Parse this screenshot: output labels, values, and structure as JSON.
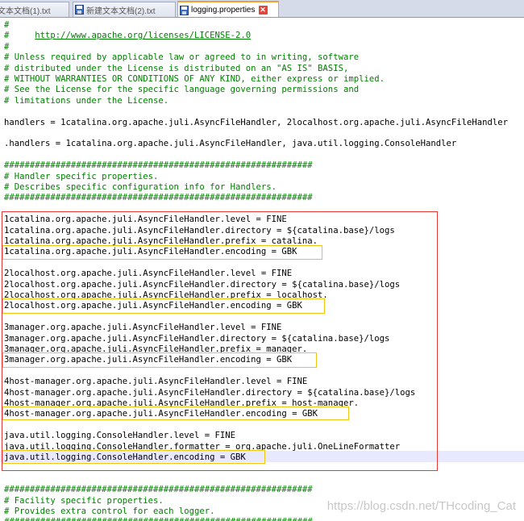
{
  "tabs": [
    {
      "label": "文本文档(1).txt",
      "active": false
    },
    {
      "label": "新建文本文档(2).txt",
      "active": false
    },
    {
      "label": "logging.properties",
      "active": true
    }
  ],
  "lines": [
    {
      "text": "#",
      "type": "comment"
    },
    {
      "text": "#     http://www.apache.org/licenses/LICENSE-2.0",
      "type": "comment"
    },
    {
      "text": "#",
      "type": "comment"
    },
    {
      "text": "# Unless required by applicable law or agreed to in writing, software",
      "type": "comment"
    },
    {
      "text": "# distributed under the License is distributed on an \"AS IS\" BASIS,",
      "type": "comment"
    },
    {
      "text": "# WITHOUT WARRANTIES OR CONDITIONS OF ANY KIND, either express or implied.",
      "type": "comment"
    },
    {
      "text": "# See the License for the specific language governing permissions and",
      "type": "comment"
    },
    {
      "text": "# limitations under the License.",
      "type": "comment"
    },
    {
      "text": "",
      "type": "code"
    },
    {
      "text": "handlers = 1catalina.org.apache.juli.AsyncFileHandler, 2localhost.org.apache.juli.AsyncFileHandler",
      "type": "code"
    },
    {
      "text": "",
      "type": "code"
    },
    {
      "text": ".handlers = 1catalina.org.apache.juli.AsyncFileHandler, java.util.logging.ConsoleHandler",
      "type": "code"
    },
    {
      "text": "",
      "type": "code"
    },
    {
      "text": "############################################################",
      "type": "comment"
    },
    {
      "text": "# Handler specific properties.",
      "type": "comment"
    },
    {
      "text": "# Describes specific configuration info for Handlers.",
      "type": "comment"
    },
    {
      "text": "############################################################",
      "type": "comment"
    },
    {
      "text": "",
      "type": "code"
    },
    {
      "text": "1catalina.org.apache.juli.AsyncFileHandler.level = FINE",
      "type": "code"
    },
    {
      "text": "1catalina.org.apache.juli.AsyncFileHandler.directory = ${catalina.base}/logs",
      "type": "code"
    },
    {
      "text": "1catalina.org.apache.juli.AsyncFileHandler.prefix = catalina.",
      "type": "code"
    },
    {
      "text": "1catalina.org.apache.juli.AsyncFileHandler.encoding = GBK",
      "type": "code"
    },
    {
      "text": "",
      "type": "code"
    },
    {
      "text": "2localhost.org.apache.juli.AsyncFileHandler.level = FINE",
      "type": "code"
    },
    {
      "text": "2localhost.org.apache.juli.AsyncFileHandler.directory = ${catalina.base}/logs",
      "type": "code"
    },
    {
      "text": "2localhost.org.apache.juli.AsyncFileHandler.prefix = localhost.",
      "type": "code"
    },
    {
      "text": "2localhost.org.apache.juli.AsyncFileHandler.encoding = GBK",
      "type": "code"
    },
    {
      "text": "",
      "type": "code"
    },
    {
      "text": "3manager.org.apache.juli.AsyncFileHandler.level = FINE",
      "type": "code"
    },
    {
      "text": "3manager.org.apache.juli.AsyncFileHandler.directory = ${catalina.base}/logs",
      "type": "code"
    },
    {
      "text": "3manager.org.apache.juli.AsyncFileHandler.prefix = manager.",
      "type": "code"
    },
    {
      "text": "3manager.org.apache.juli.AsyncFileHandler.encoding = GBK",
      "type": "code"
    },
    {
      "text": "",
      "type": "code"
    },
    {
      "text": "4host-manager.org.apache.juli.AsyncFileHandler.level = FINE",
      "type": "code"
    },
    {
      "text": "4host-manager.org.apache.juli.AsyncFileHandler.directory = ${catalina.base}/logs",
      "type": "code"
    },
    {
      "text": "4host-manager.org.apache.juli.AsyncFileHandler.prefix = host-manager.",
      "type": "code"
    },
    {
      "text": "4host-manager.org.apache.juli.AsyncFileHandler.encoding = GBK",
      "type": "code"
    },
    {
      "text": "",
      "type": "code"
    },
    {
      "text": "java.util.logging.ConsoleHandler.level = FINE",
      "type": "code"
    },
    {
      "text": "java.util.logging.ConsoleHandler.formatter = org.apache.juli.OneLineFormatter",
      "type": "code"
    },
    {
      "text": "java.util.logging.ConsoleHandler.encoding = GBK",
      "type": "code"
    },
    {
      "text": "",
      "type": "code"
    },
    {
      "text": "",
      "type": "code"
    },
    {
      "text": "############################################################",
      "type": "comment"
    },
    {
      "text": "# Facility specific properties.",
      "type": "comment"
    },
    {
      "text": "# Provides extra control for each logger.",
      "type": "comment"
    },
    {
      "text": "############################################################",
      "type": "comment"
    }
  ],
  "watermark": "https://blog.csdn.net/THcoding_Cat",
  "colors": {
    "comment": "#008000",
    "code": "#000000",
    "highlight_red": "#e53935",
    "highlight_yellow": "#f1c40f",
    "caret_line": "#e8e8ff"
  }
}
